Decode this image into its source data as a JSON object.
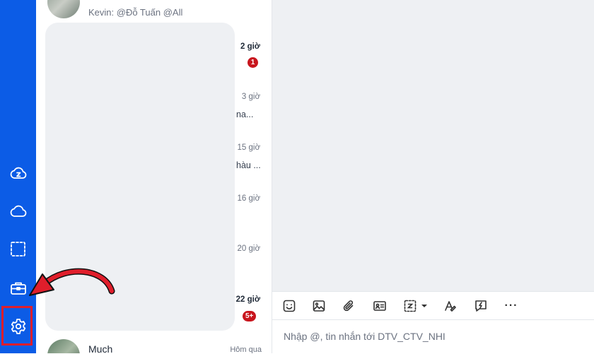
{
  "sidebar": {
    "items": [
      {
        "name": "zcloud",
        "icon": "zalo-cloud-icon"
      },
      {
        "name": "cloud",
        "icon": "cloud-icon"
      },
      {
        "name": "screenshot",
        "icon": "screenshot-icon"
      },
      {
        "name": "toolbox",
        "icon": "briefcase-icon"
      },
      {
        "name": "settings",
        "icon": "gear-icon"
      }
    ],
    "highlight_color": "#e01e2b",
    "bg_color": "#0c5ce6"
  },
  "conversations": {
    "top_preview": "Kevin: @Đỗ Tuấn @All",
    "items": [
      {
        "time": "2 giờ",
        "badge": "1",
        "snippet": ""
      },
      {
        "time": "3 giờ",
        "badge": "",
        "snippet": "na..."
      },
      {
        "time": "15 giờ",
        "badge": "",
        "snippet": "hàu ..."
      },
      {
        "time": "16 giờ",
        "badge": "",
        "snippet": ""
      },
      {
        "time": "20 giờ",
        "badge": "",
        "snippet": ""
      },
      {
        "time": "22 giờ",
        "badge": "5+",
        "snippet": ""
      }
    ],
    "bottom": {
      "name": "Much",
      "time": "Hôm qua"
    }
  },
  "composer": {
    "placeholder": "Nhập @, tin nhắn tới DTV_CTV_NHI"
  },
  "toolbar": {
    "tools": [
      "sticker-icon",
      "image-icon",
      "attach-icon",
      "contact-card-icon",
      "screenshot-icon",
      "text-format-icon",
      "quick-message-icon",
      "more-icon"
    ],
    "more_label": "···"
  }
}
